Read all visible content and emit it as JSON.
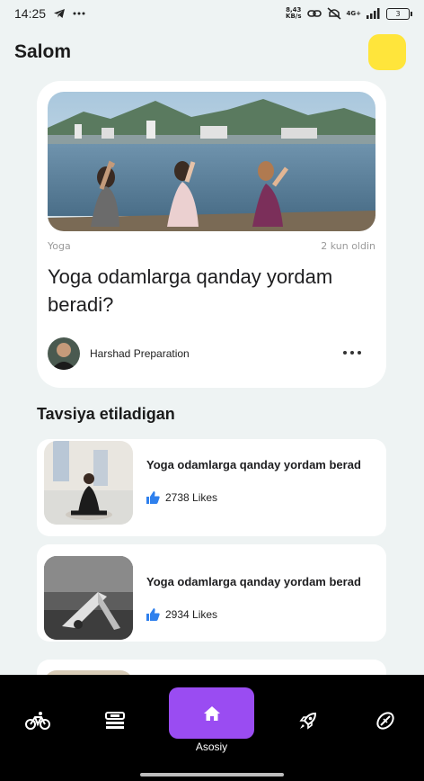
{
  "status_bar": {
    "time": "14:25",
    "speed_value": "8,43",
    "speed_unit": "KB/s",
    "network": "4G+",
    "battery": "3"
  },
  "header": {
    "greeting": "Salom"
  },
  "featured": {
    "category": "Yoga",
    "time_ago": "2 kun oldin",
    "title": "Yoga odamlarga qanday yordam beradi?",
    "author": "Harshad Preparation"
  },
  "recommended": {
    "section_title": "Tavsiya etiladigan",
    "items": [
      {
        "title": "Yoga odamlarga qanday yordam berad",
        "likes": "2738 Likes"
      },
      {
        "title": "Yoga odamlarga qanday yordam berad",
        "likes": "2934 Likes"
      }
    ]
  },
  "bottom_nav": {
    "home_label": "Asosiy",
    "items": [
      "bike-icon",
      "workout-icon",
      "home-icon",
      "rocket-icon",
      "ball-icon"
    ]
  },
  "colors": {
    "accent": "#9a4cf2",
    "profile": "#ffe53b",
    "like": "#2f80ed",
    "background": "#eef3f3"
  }
}
